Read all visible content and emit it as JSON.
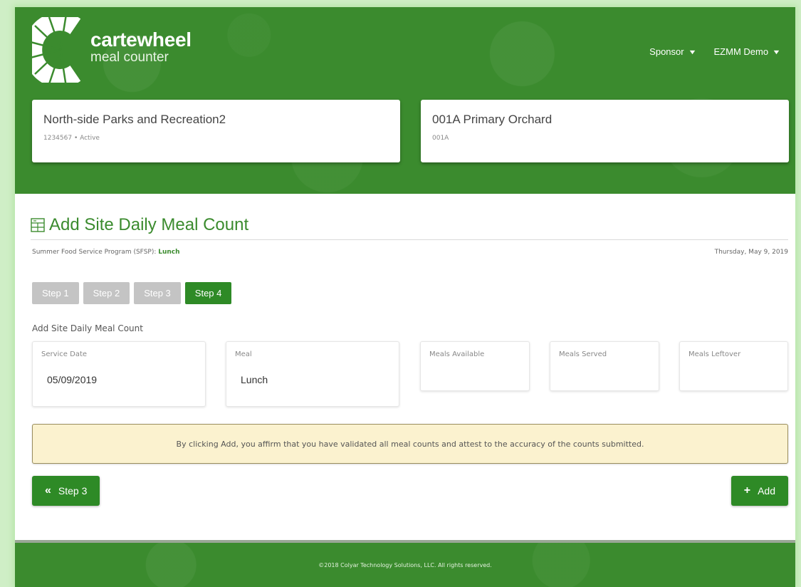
{
  "brand": {
    "name": "cartewheel",
    "subtitle": "meal counter"
  },
  "top_nav": {
    "sponsor_label": "Sponsor",
    "user_label": "EZMM Demo"
  },
  "sponsor_card": {
    "title": "North-side Parks and Recreation2",
    "subtitle": "1234567 • Active"
  },
  "site_card": {
    "title": "001A Primary Orchard",
    "subtitle": "001A"
  },
  "page": {
    "title": "Add Site Daily Meal Count",
    "program": "Summer Food Service Program (SFSP): ",
    "meal_type": "Lunch",
    "date": "Thursday, May 9, 2019"
  },
  "steps": [
    {
      "label": "Step 1",
      "active": false
    },
    {
      "label": "Step 2",
      "active": false
    },
    {
      "label": "Step 3",
      "active": false
    },
    {
      "label": "Step 4",
      "active": true
    }
  ],
  "form": {
    "section_label": "Add Site Daily Meal Count",
    "service_date": {
      "label": "Service Date",
      "value": "05/09/2019"
    },
    "meal": {
      "label": "Meal",
      "value": "Lunch"
    },
    "meals_available": {
      "label": "Meals Available",
      "value": ""
    },
    "meals_served": {
      "label": "Meals Served",
      "value": ""
    },
    "meals_leftover": {
      "label": "Meals Leftover",
      "value": ""
    }
  },
  "notice": "By clicking Add, you affirm that you have validated all meal counts and attest to the accuracy of the counts submitted.",
  "buttons": {
    "back_label": "Step 3",
    "back_icon": "«",
    "add_label": "Add",
    "add_icon": "+"
  },
  "footer": {
    "copyright": "©2018 Colyar Technology Solutions, LLC. All rights reserved."
  },
  "colors": {
    "brand_green": "#3b8b2e",
    "active_step": "#2e8a26",
    "inactive_step": "#c4c4c4",
    "notice_bg": "#fbf2cf"
  }
}
